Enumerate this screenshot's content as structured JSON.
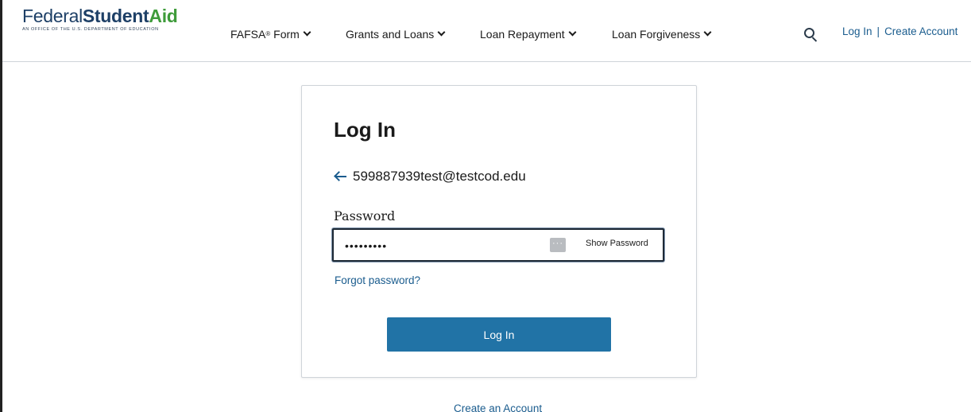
{
  "header": {
    "logo": {
      "federal": "Federal",
      "student": "Student",
      "aid": "Aid",
      "subtitle": "An OFFICE of the U.S. DEPARTMENT of EDUCATION"
    },
    "nav": [
      {
        "label": "FAFSA",
        "sup": "®",
        "suffix": " Form"
      },
      {
        "label": "Grants and Loans"
      },
      {
        "label": "Loan Repayment"
      },
      {
        "label": "Loan Forgiveness"
      }
    ],
    "login_link": "Log In",
    "separator": "|",
    "create_link": "Create Account"
  },
  "card": {
    "title": "Log In",
    "email": "599887939test@testcod.edu",
    "password_label": "Password",
    "password_value": "•••••••••",
    "show_password": "Show Password",
    "forgot_password": "Forgot password?",
    "login_button": "Log In"
  },
  "footer": {
    "create_account": "Create an Account"
  },
  "colors": {
    "brand_blue": "#1d3f66",
    "brand_green": "#3e9b3a",
    "link": "#1a5c8e",
    "button": "#2173a6"
  },
  "icons": [
    "search-icon",
    "back-arrow-icon",
    "chevron-down-icon",
    "password-manager-icon"
  ]
}
